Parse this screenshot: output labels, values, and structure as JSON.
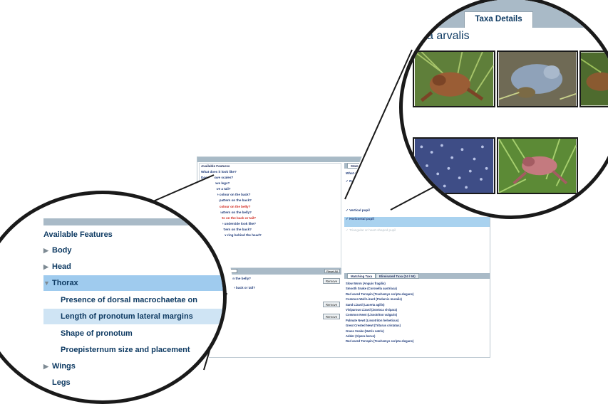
{
  "app": {
    "left_panel": {
      "header": "Available Features",
      "questions": [
        {
          "text": "What does it look like?",
          "red": false
        },
        {
          "text": "Does it have scales?",
          "red": false
        },
        {
          "text": "Does it have legs?",
          "red": false
        },
        {
          "text": "Does it have a tail?",
          "red": false
        },
        {
          "text": "What is the colour on the back?",
          "red": false
        },
        {
          "text": "What is the pattern on the back?",
          "red": false
        },
        {
          "text": "What is the colour on the belly?",
          "red": true
        },
        {
          "text": "What is the pattern on the belly?",
          "red": false
        },
        {
          "text": "",
          "red": false
        },
        {
          "text": "",
          "red": false
        },
        {
          "text": "",
          "red": false
        },
        {
          "text": "Are there spots on the back or tail?",
          "red": true
        },
        {
          "text": "",
          "red": false
        },
        {
          "text": "What does the underside look like?",
          "red": false
        },
        {
          "text": "What is the pattern on the back?",
          "red": false
        },
        {
          "text": "Is there a yellow ring behind the head?",
          "red": false
        }
      ],
      "select_value": "en",
      "reset_all": "Reset All",
      "chosen_lines": [
        "What is the pattern on the belly?",
        "Yellow coloured",
        "",
        "",
        "Are there spots on the back or tail?",
        "Does it have a crest",
        "",
        "Does it have a tail?",
        "Round pupil",
        "Vertical pupil"
      ],
      "remove_label": "Remove"
    },
    "right_panel": {
      "tabs": [
        "States",
        "Taxa Details"
      ],
      "question": "What does the pupil look like?",
      "states": [
        "Round pupil",
        "Vertical pupil",
        "Horizontal pupil",
        "Triangular or heart-shaped pupil"
      ],
      "bottom_tabs": [
        "Matching Taxa",
        "Eliminated Taxa (24 / 50)"
      ],
      "matching_taxa": [
        "Slow Worm (Anguis fragilis)",
        "Smooth Snake (Coronella austriaca)",
        "Red eared Terrapin (Trachemys scripta elegans)",
        "Common Wall Lizard (Podarcis muralis)",
        "Sand Lizard (Lacerta agilis)",
        "Viviparous Lizard (Zootoca vivipara)",
        "Common Newt (Lissotriton vulgaris)",
        "Palmate Newt (Lissotriton helveticus)",
        "Great Crested Newt (Triturus cristatus)",
        "Grass Snake (Natrix natrix)",
        "Adder (Vipera berus)",
        "Red eared Terrapin (Trachemys scripta elegans)"
      ]
    }
  },
  "zoom_left": {
    "header": "Available Features",
    "rows": [
      {
        "label": "Body",
        "caret": "▶",
        "indent": false,
        "highlight": "none"
      },
      {
        "label": "Head",
        "caret": "▶",
        "indent": false,
        "highlight": "none"
      },
      {
        "label": "Thorax",
        "caret": "▼",
        "indent": false,
        "highlight": "strong"
      },
      {
        "label": "Presence of dorsal macrochaetae on",
        "caret": "",
        "indent": true,
        "highlight": "none"
      },
      {
        "label": "Length of pronotum lateral margins",
        "caret": "",
        "indent": true,
        "highlight": "light"
      },
      {
        "label": "Shape of pronotum",
        "caret": "",
        "indent": true,
        "highlight": "none"
      },
      {
        "label": "Proepisternum size and placement",
        "caret": "",
        "indent": true,
        "highlight": "none"
      },
      {
        "label": "Wings",
        "caret": "▶",
        "indent": false,
        "highlight": "none"
      },
      {
        "label": "Legs",
        "caret": "",
        "indent": false,
        "highlight": "none"
      }
    ]
  },
  "zoom_right": {
    "tab_label": "Taxa Details",
    "taxon_name": "a arvalis"
  },
  "colors": {
    "bar": "#a9bac7",
    "highlight": "#9fcbee",
    "text_dark_blue": "#0f3b63"
  }
}
